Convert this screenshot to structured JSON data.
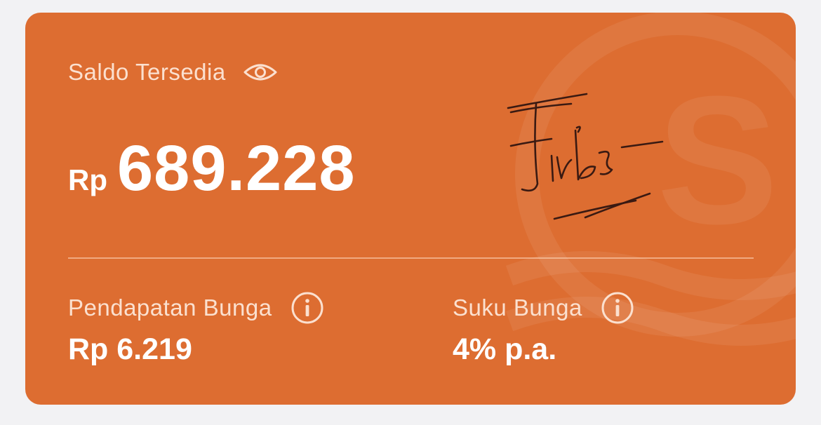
{
  "balance": {
    "label": "Saldo Tersedia",
    "currency": "Rp",
    "amount": "689.228",
    "visibility_icon": "eye-icon"
  },
  "interest_income": {
    "label": "Pendapatan Bunga",
    "value": "Rp 6.219",
    "icon": "info-icon"
  },
  "interest_rate": {
    "label": "Suku Bunga",
    "value": "4% p.a.",
    "icon": "info-icon"
  },
  "colors": {
    "card_background": "#dd6d31",
    "page_background": "#f2f2f4",
    "label_text": "#fbe0cf",
    "value_text": "#ffffff"
  }
}
